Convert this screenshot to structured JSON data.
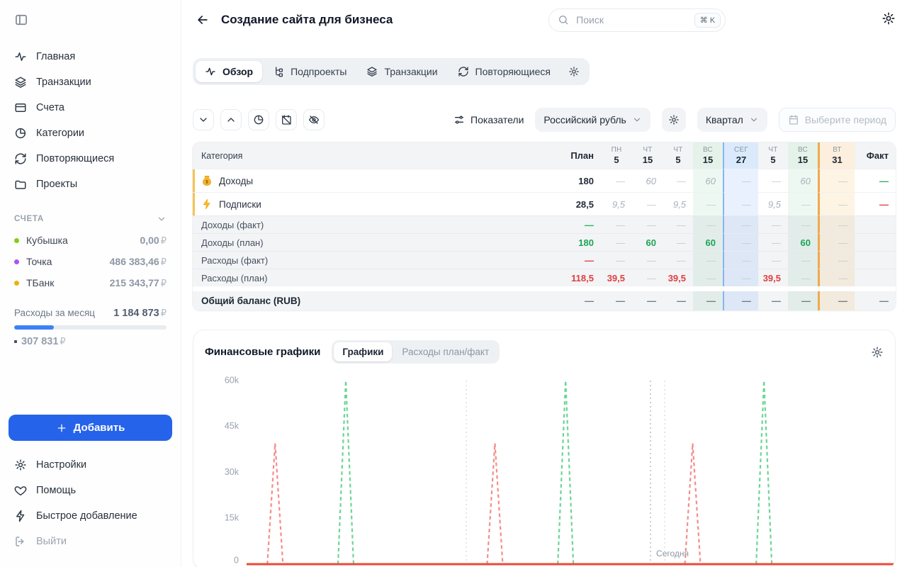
{
  "sidebar": {
    "nav": [
      {
        "id": "home",
        "icon": "pulse-icon",
        "label": "Главная"
      },
      {
        "id": "transactions",
        "icon": "layers-icon",
        "label": "Транзакции"
      },
      {
        "id": "accounts",
        "icon": "wallet-icon",
        "label": "Счета"
      },
      {
        "id": "categories",
        "icon": "pie-icon",
        "label": "Категории"
      },
      {
        "id": "recurring",
        "icon": "refresh-icon",
        "label": "Повторяющиеся"
      },
      {
        "id": "projects",
        "icon": "folder-icon",
        "label": "Проекты"
      }
    ],
    "accounts": {
      "title": "СЧЕТА",
      "items": [
        {
          "name": "Кубышка",
          "amount": "0,00",
          "currency": "₽",
          "color": "#84cc16"
        },
        {
          "name": "Точка",
          "amount": "486 383,46",
          "currency": "₽",
          "color": "#a855f7"
        },
        {
          "name": "ТБанк",
          "amount": "215 343,77",
          "currency": "₽",
          "color": "#eab308"
        }
      ]
    },
    "monthly": {
      "label": "Расходы за месяц",
      "amount": "1 184 873",
      "currency": "₽",
      "progress_pct": 26,
      "accent": "#3b82f6",
      "sub_amount": "307 831",
      "sub_currency": "₽"
    },
    "add_button": {
      "label": "Добавить",
      "color": "#2563eb"
    },
    "footer": [
      {
        "id": "settings",
        "icon": "gear-icon",
        "label": "Настройки"
      },
      {
        "id": "help",
        "icon": "heart-icon",
        "label": "Помощь"
      },
      {
        "id": "quick-add",
        "icon": "bolt-icon",
        "label": "Быстрое добавление"
      },
      {
        "id": "logout",
        "icon": "logout-icon",
        "label": "Выйти",
        "muted": true
      }
    ]
  },
  "header": {
    "title": "Создание сайта для бизнеса",
    "search": {
      "placeholder": "Поиск",
      "shortcut": "⌘ K"
    }
  },
  "project_tabs": {
    "items": [
      {
        "id": "overview",
        "icon": "pulse-icon",
        "label": "Обзор",
        "active": true
      },
      {
        "id": "subprojects",
        "icon": "tree-icon",
        "label": "Подпроекты"
      },
      {
        "id": "transactions",
        "icon": "layers-icon",
        "label": "Транзакции"
      },
      {
        "id": "recurring",
        "icon": "refresh-icon",
        "label": "Повторяющиеся"
      }
    ]
  },
  "toolbar": {
    "metrics_label": "Показатели",
    "currency": "Российский рубль",
    "period": "Квартал",
    "date_range_placeholder": "Выберите период"
  },
  "table": {
    "columns": [
      {
        "id": "category",
        "label": "Категория"
      },
      {
        "id": "plan",
        "label": "План"
      },
      {
        "id": "d1",
        "day": "ПН",
        "date": "5"
      },
      {
        "id": "d2",
        "day": "ЧТ",
        "date": "15"
      },
      {
        "id": "d3",
        "day": "ЧТ",
        "date": "5"
      },
      {
        "id": "d4",
        "day": "ВС",
        "date": "15",
        "tint": "weekend"
      },
      {
        "id": "d5",
        "day": "СЕГ",
        "date": "27",
        "tint": "today"
      },
      {
        "id": "d6",
        "day": "ЧТ",
        "date": "5"
      },
      {
        "id": "d7",
        "day": "ВС",
        "date": "15",
        "tint": "weekend"
      },
      {
        "id": "d8",
        "day": "ВТ",
        "date": "31",
        "tint": "monthend"
      },
      {
        "id": "fact",
        "label": "Факт"
      }
    ],
    "rows": [
      {
        "kind": "category",
        "icon": "money-bag-icon",
        "name": "Доходы",
        "accent": "#f6c453",
        "cells": [
          [
            "180",
            "num"
          ],
          [
            "—",
            "dash"
          ],
          [
            "60",
            "muted"
          ],
          [
            "—",
            "dash"
          ],
          [
            "60",
            "muted"
          ],
          [
            "—",
            "dash"
          ],
          [
            "—",
            "dash"
          ],
          [
            "60",
            "muted"
          ],
          [
            "—",
            "dash"
          ],
          [
            "—",
            "dash-green"
          ]
        ]
      },
      {
        "kind": "category",
        "icon": "lightning-icon",
        "name": "Подписки",
        "accent": "#f6c453",
        "cells": [
          [
            "28,5",
            "num"
          ],
          [
            "9,5",
            "muted"
          ],
          [
            "—",
            "dash"
          ],
          [
            "9,5",
            "muted"
          ],
          [
            "—",
            "dash"
          ],
          [
            "—",
            "dash"
          ],
          [
            "9,5",
            "muted"
          ],
          [
            "—",
            "dash"
          ],
          [
            "—",
            "dash"
          ],
          [
            "—",
            "dash-red"
          ]
        ]
      },
      {
        "kind": "metric",
        "name": "Доходы (факт)",
        "cells": [
          [
            "—",
            "dash-green"
          ],
          [
            "—",
            "dash"
          ],
          [
            "—",
            "dash"
          ],
          [
            "—",
            "dash"
          ],
          [
            "—",
            "dash"
          ],
          [
            "—",
            "dash"
          ],
          [
            "—",
            "dash"
          ],
          [
            "—",
            "dash"
          ],
          [
            "—",
            "dash"
          ],
          [
            "",
            "empty"
          ]
        ]
      },
      {
        "kind": "metric",
        "name": "Доходы (план)",
        "cells": [
          [
            "180",
            "green"
          ],
          [
            "—",
            "dash"
          ],
          [
            "60",
            "green"
          ],
          [
            "—",
            "dash"
          ],
          [
            "60",
            "green"
          ],
          [
            "—",
            "dash"
          ],
          [
            "—",
            "dash"
          ],
          [
            "60",
            "green"
          ],
          [
            "—",
            "dash"
          ],
          [
            "",
            "empty"
          ]
        ]
      },
      {
        "kind": "metric",
        "name": "Расходы (факт)",
        "cells": [
          [
            "—",
            "dash-red"
          ],
          [
            "—",
            "dash"
          ],
          [
            "—",
            "dash"
          ],
          [
            "—",
            "dash"
          ],
          [
            "—",
            "dash"
          ],
          [
            "—",
            "dash"
          ],
          [
            "—",
            "dash"
          ],
          [
            "—",
            "dash"
          ],
          [
            "—",
            "dash"
          ],
          [
            "",
            "empty"
          ]
        ]
      },
      {
        "kind": "metric",
        "name": "Расходы (план)",
        "cells": [
          [
            "118,5",
            "red"
          ],
          [
            "39,5",
            "red"
          ],
          [
            "—",
            "dash"
          ],
          [
            "39,5",
            "red"
          ],
          [
            "—",
            "dash"
          ],
          [
            "—",
            "dash"
          ],
          [
            "39,5",
            "red"
          ],
          [
            "—",
            "dash"
          ],
          [
            "—",
            "dash"
          ],
          [
            "",
            "empty"
          ]
        ]
      },
      {
        "kind": "total",
        "gap_before": true,
        "name": "Общий баланс (RUB)",
        "cells": [
          [
            "—",
            "dash-dark"
          ],
          [
            "—",
            "dash-dark"
          ],
          [
            "—",
            "dash-dark"
          ],
          [
            "—",
            "dash-dark"
          ],
          [
            "—",
            "dash-dark"
          ],
          [
            "—",
            "dash-dark"
          ],
          [
            "—",
            "dash-dark"
          ],
          [
            "—",
            "dash-dark"
          ],
          [
            "—",
            "dash-dark"
          ],
          [
            "—",
            "dash-dark"
          ]
        ]
      }
    ]
  },
  "charts_card": {
    "title": "Финансовые графики",
    "tabs": [
      {
        "label": "Графики",
        "active": true
      },
      {
        "label": "Расходы план/факт",
        "active": false
      }
    ]
  },
  "chart_data": {
    "type": "line",
    "title": "Финансовые графики",
    "ylim": [
      0,
      60000
    ],
    "y_ticks": [
      {
        "v": 0,
        "label": "0"
      },
      {
        "v": 15000,
        "label": "15k"
      },
      {
        "v": 30000,
        "label": "30k"
      },
      {
        "v": 45000,
        "label": "45k"
      },
      {
        "v": 60000,
        "label": "60k"
      }
    ],
    "series": [
      {
        "name": "Доходы (план)",
        "color": "#6bd695",
        "style": "dashed",
        "spikes": [
          {
            "x": 0.153,
            "value": 60000
          },
          {
            "x": 0.492,
            "value": 60000
          },
          {
            "x": 0.798,
            "value": 60000
          }
        ]
      },
      {
        "name": "Расходы (план)",
        "color": "#f58c8c",
        "style": "dashed",
        "spikes": [
          {
            "x": 0.044,
            "value": 39500
          },
          {
            "x": 0.383,
            "value": 39500
          },
          {
            "x": 0.688,
            "value": 39500
          }
        ]
      }
    ],
    "month_gridlines_x": [
      0.339,
      0.645
    ],
    "today": {
      "x": 0.623,
      "label": "Сегодня"
    },
    "baseline": {
      "value": 0,
      "color": "#ee4836"
    },
    "legend": "none",
    "grid": "vertical-dashed"
  }
}
